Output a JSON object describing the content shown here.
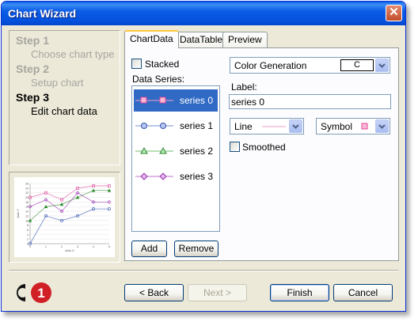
{
  "window": {
    "title": "Chart Wizard",
    "close_icon": "close-icon"
  },
  "steps": [
    {
      "title": "Step 1",
      "desc": "Choose chart type",
      "state": "done"
    },
    {
      "title": "Step 2",
      "desc": "Setup chart",
      "state": "done"
    },
    {
      "title": "Step 3",
      "desc": "Edit chart data",
      "state": "active"
    }
  ],
  "tabs": [
    {
      "label": "ChartData",
      "selected": true
    },
    {
      "label": "DataTable",
      "selected": false
    },
    {
      "label": "Preview",
      "selected": false
    }
  ],
  "chart_data_tab": {
    "stacked_label": "Stacked",
    "stacked_checked": false,
    "series_list_label": "Data Series:",
    "series": [
      {
        "name": "series 0",
        "color": "#e0479b",
        "marker": "square",
        "selected": true
      },
      {
        "name": "series 1",
        "color": "#3150b0",
        "marker": "circle",
        "selected": false
      },
      {
        "name": "series 2",
        "color": "#2b8a2b",
        "marker": "triangle",
        "selected": false
      },
      {
        "name": "series 3",
        "color": "#9a31b0",
        "marker": "diamond",
        "selected": false
      }
    ],
    "add_button": "Add",
    "remove_button": "Remove",
    "color_generation": {
      "label": "Color Generation",
      "value": "C"
    },
    "label_caption": "Label:",
    "label_value": "series 0",
    "line_combo": {
      "label": "Line",
      "color": "#e0479b"
    },
    "symbol_combo": {
      "label": "Symbol",
      "color": "#e0479b"
    },
    "smoothed_label": "Smoothed",
    "smoothed_checked": false
  },
  "preview_chart": {
    "y_ticks": [
      "0",
      "2",
      "4",
      "6",
      "8",
      "10",
      "12",
      "14",
      "16",
      "18",
      "20",
      "22",
      "24",
      "26"
    ],
    "x_ticks": [
      "0",
      "1",
      "2",
      "3",
      "4",
      "5"
    ],
    "x_label": "Axis X",
    "y_label": "Axis Y"
  },
  "footer": {
    "logo_text": "C1",
    "back_button": "< Back",
    "next_button": "Next >",
    "finish_button": "Finish",
    "cancel_button": "Cancel"
  },
  "chart_data": {
    "type": "line",
    "x": [
      0,
      1,
      2,
      3,
      4,
      5
    ],
    "ylim": [
      0,
      26
    ],
    "xlabel": "Axis X",
    "ylabel": "Axis Y",
    "series": [
      {
        "name": "series 0",
        "values": [
          20,
          22,
          19,
          24,
          25,
          25
        ],
        "color": "#e0479b"
      },
      {
        "name": "series 1",
        "values": [
          0,
          12,
          10,
          12,
          15,
          15
        ],
        "color": "#3150b0"
      },
      {
        "name": "series 2",
        "values": [
          10,
          16,
          17,
          20,
          23,
          23
        ],
        "color": "#2b8a2b"
      },
      {
        "name": "series 3",
        "values": [
          16,
          19,
          14,
          22,
          18,
          18
        ],
        "color": "#9a31b0"
      }
    ]
  }
}
